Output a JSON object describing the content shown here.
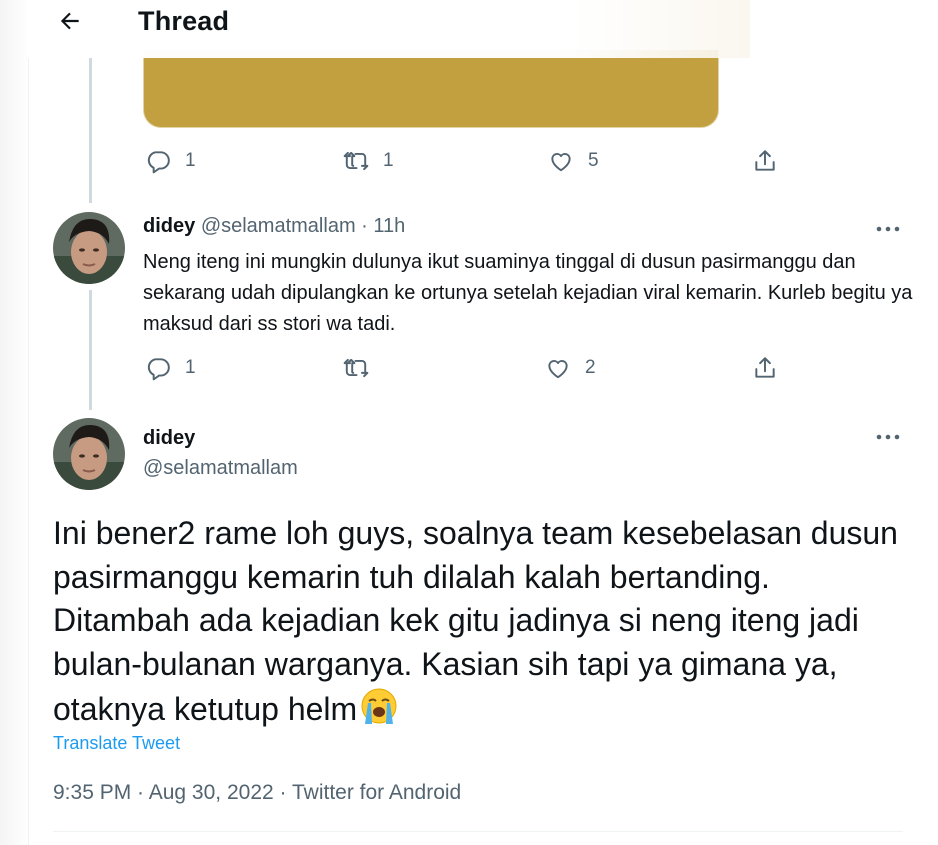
{
  "header": {
    "title": "Thread"
  },
  "first_tweet_actions": {
    "replies": "1",
    "retweets": "1",
    "likes": "5"
  },
  "reply": {
    "name": "didey",
    "handle": "@selamatmallam",
    "separator": " · ",
    "time": "11h",
    "text": "Neng iteng ini mungkin dulunya ikut suaminya tinggal di dusun pasirmanggu dan sekarang udah dipulangkan ke ortunya setelah kejadian viral kemarin. Kurleb begitu ya maksud dari ss stori wa tadi.",
    "replies": "1",
    "likes": "2"
  },
  "main": {
    "name": "didey",
    "handle": "@selamatmallam",
    "text": "Ini bener2 rame loh guys, soalnya team kesebelasan dusun pasirmanggu kemarin tuh dilalah kalah bertanding. Ditambah ada kejadian kek gitu jadinya si neng iteng jadi bulan-bulanan warganya. Kasian sih tapi ya gimana ya, otaknya ketutup helm",
    "translate": "Translate Tweet",
    "time": "9:35 PM",
    "date": "Aug 30, 2022",
    "source": "Twitter for Android",
    "meta_sep": " · "
  },
  "colors": {
    "accent": "#1d9bf0",
    "text": "#0f1419",
    "muted": "#536471",
    "media": "#c3a03f"
  },
  "icons": [
    "back-arrow-icon",
    "reply-icon",
    "retweet-icon",
    "like-icon",
    "share-icon",
    "more-icon",
    "crying-emoji"
  ]
}
